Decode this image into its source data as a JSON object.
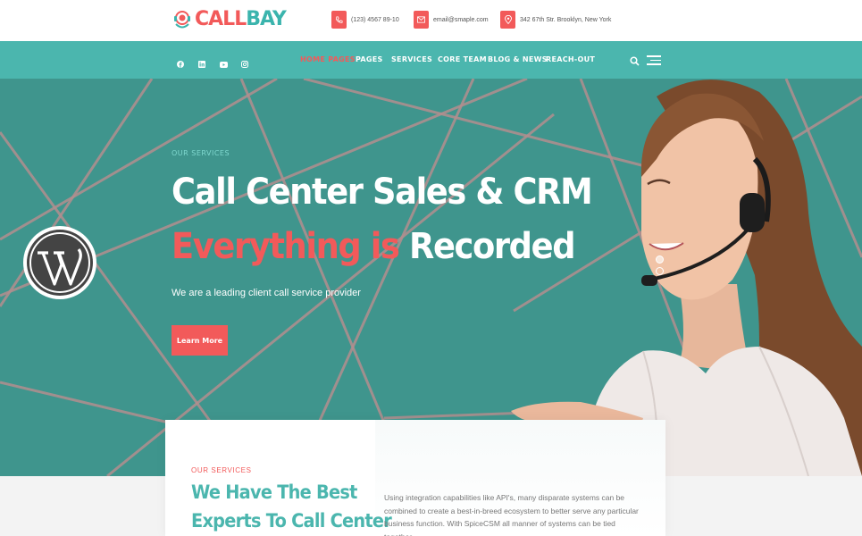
{
  "brand": {
    "name_part1": "CALL",
    "name_part2": "BAY"
  },
  "contacts": {
    "phone": "(123) 4567 89-10",
    "email": "email@smaple.com",
    "address": "342 67th Str. Brooklyn, New York"
  },
  "social": [
    "facebook-icon",
    "linkedin-icon",
    "youtube-icon",
    "instagram-icon"
  ],
  "nav": {
    "items": [
      {
        "label": "HOME PAGES",
        "active": true
      },
      {
        "label": "PAGES"
      },
      {
        "label": "SERVICES"
      },
      {
        "label": "CORE TEAM"
      },
      {
        "label": "BLOG & NEWS"
      },
      {
        "label": "REACH-OUT"
      }
    ]
  },
  "hero": {
    "eyebrow": "OUR SERVICES",
    "title": "Call Center Sales & CRM",
    "subtitle_highlight": "Everything is",
    "subtitle_rest": "Recorded",
    "description": "We are a leading client call service provider",
    "button": "Learn More"
  },
  "about": {
    "eyebrow": "OUR SERVICES",
    "title_line1": "We Have The Best",
    "title_line2": "Experts To Call Center",
    "text": "Using integration capabilities like API's, many disparate systems can be combined to create a best-in-breed ecosystem to better serve any particular business function. With SpiceCSM all manner of systems can be tied together,"
  },
  "colors": {
    "accent_red": "#f25a5a",
    "teal": "#4bb6ae",
    "hero_bg": "#3f958d"
  }
}
